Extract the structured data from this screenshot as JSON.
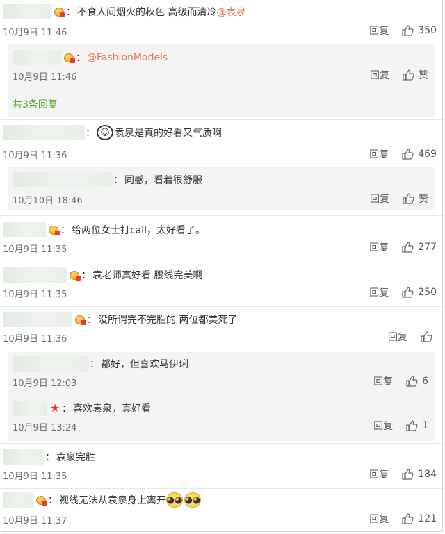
{
  "labels": {
    "reply": "回复",
    "like": "赞",
    "more_replies": "共3条回复"
  },
  "comments": [
    {
      "text": "不食人间烟火的秋色 高级而清冷",
      "mention": "@袁泉",
      "time": "10月9日 11:46",
      "likes": "350"
    },
    {
      "mention": "@FashionModels",
      "time": "10月9日 11:46",
      "likes": "赞"
    },
    {
      "text": "袁泉是真的好看又气质啊",
      "time": "10月9日 11:36",
      "likes": "469"
    },
    {
      "text": "同感，看着很舒服",
      "time": "10月10日 18:46",
      "likes": "赞"
    },
    {
      "text": "给两位女士打call，太好看了。",
      "time": "10月9日 11:35",
      "likes": "277"
    },
    {
      "text": "袁老师真好看 腰线完美啊",
      "time": "10月9日 11:35",
      "likes": "250"
    },
    {
      "text": "没所谓完不完胜的 两位都美死了",
      "time": "10月9日 11:36",
      "likes": ""
    },
    {
      "text": "都好，但喜欢马伊琍",
      "time": "10月9日 12:03",
      "likes": "6"
    },
    {
      "text": "喜欢袁泉，真好看",
      "time": "10月9日 13:24",
      "likes": "1"
    },
    {
      "text": "袁泉完胜",
      "time": "10月9日 11:35",
      "likes": "184"
    },
    {
      "text": "视线无法从袁泉身上离开",
      "time": "10月9日 11:37",
      "likes": "121"
    }
  ],
  "icons": {
    "vip_badge": "vip-badge-icon",
    "star_badge": "star-icon",
    "thumb": "thumbs-up-icon",
    "emoji": "smiling-face-icon"
  },
  "colors": {
    "accent_green": "#5aa835",
    "mention": "#eb7350",
    "reply_bg": "#f4f4f4"
  }
}
